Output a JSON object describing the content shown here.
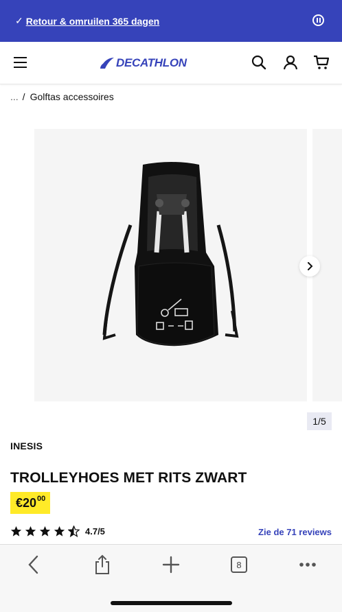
{
  "promo": {
    "check": "✓",
    "link": "Retour & omruilen 365 dagen"
  },
  "header": {
    "logo": "DECATHLON"
  },
  "breadcrumb": {
    "dots": "...",
    "separator": "/",
    "current": "Golftas accessoires"
  },
  "gallery": {
    "counter": "1/5"
  },
  "product": {
    "brand": "INESIS",
    "title": "TROLLEYHOES MET RITS ZWART",
    "price_main": "€20",
    "price_cents": "00",
    "rating_score": "4.7/5",
    "rating_value": 4.7,
    "reviews_link": "Zie de 71 reviews"
  },
  "browser": {
    "tabs_count": "8"
  },
  "colors": {
    "brand_blue": "#3643ba",
    "price_yellow": "#ffea28"
  }
}
